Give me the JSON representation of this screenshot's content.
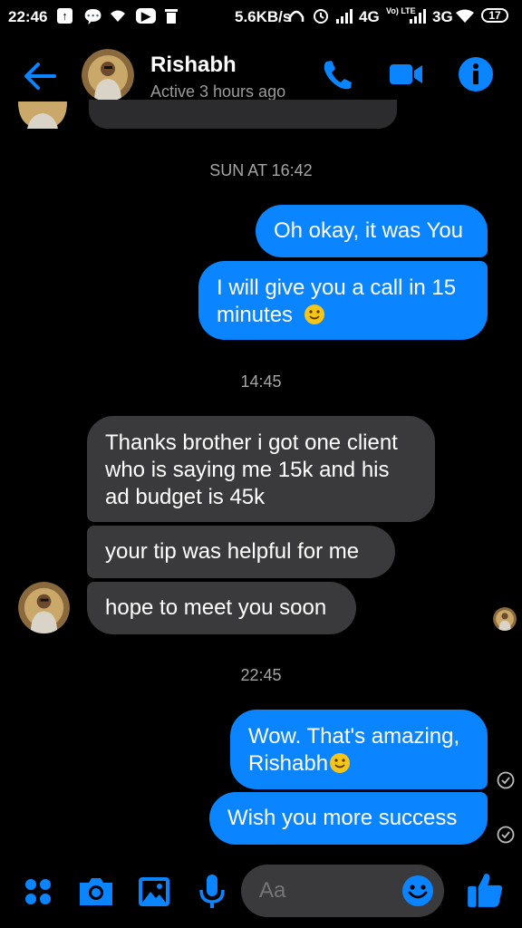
{
  "status_bar": {
    "time": "22:46",
    "network_speed": "5.6KB/s",
    "network_4g": "4G",
    "volte": "Vo) LTE",
    "network_3g": "3G",
    "battery": "17"
  },
  "header": {
    "name": "Rishabh",
    "status": "Active 3 hours ago"
  },
  "messages": {
    "ts1": "SUN AT 16:42",
    "m1": "Oh okay, it was You",
    "m2_line1": "I will give you a call in 15",
    "m2_line2": "minutes",
    "ts2": "14:45",
    "m3_line1": "Thanks brother i got one client",
    "m3_line2": "who is saying me 15k and his",
    "m3_line3": "ad budget is 45k",
    "m4": "your tip was helpful for me",
    "m5": "hope to meet you soon",
    "ts3": "22:45",
    "m6_line1": "Wow. That's amazing,",
    "m6_line2": "Rishabh",
    "m7": "Wish you more success"
  },
  "composer": {
    "placeholder": "Aa"
  },
  "icons": {
    "back": "arrow-left-icon",
    "call": "phone-icon",
    "video": "video-camera-icon",
    "info": "info-icon",
    "more": "four-dots-icon",
    "camera": "camera-icon",
    "gallery": "image-icon",
    "mic": "microphone-icon",
    "emoji": "smiley-icon",
    "like": "thumbs-up-icon"
  },
  "colors": {
    "accent": "#0a84ff",
    "received_bubble": "#3a3a3c",
    "background": "#000000"
  }
}
